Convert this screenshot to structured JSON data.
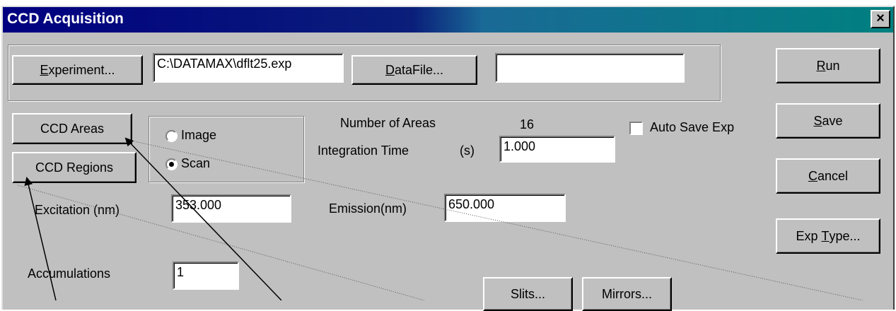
{
  "window": {
    "title": "CCD Acquisition",
    "close_glyph": "×"
  },
  "top_group": {
    "experiment_button": {
      "mnemonic": "E",
      "rest": "xperiment..."
    },
    "experiment_path": "C:\\DATAMAX\\dflt25.exp",
    "datafile_button": {
      "mnemonic": "D",
      "rest": "ataFile..."
    },
    "datafile_value": ""
  },
  "right_buttons": {
    "run": {
      "mnemonic": "R",
      "rest": "un"
    },
    "save": {
      "mnemonic": "S",
      "rest": "ave"
    },
    "cancel": {
      "mnemonic": "C",
      "rest": "ancel"
    },
    "exp_type": {
      "before": "Exp ",
      "mnemonic": "T",
      "rest": "ype..."
    }
  },
  "ccd": {
    "areas_button": "CCD Areas",
    "regions_button": "CCD Regions",
    "mode_options": [
      {
        "label": "Image",
        "selected": false
      },
      {
        "label": "Scan",
        "selected": true
      }
    ]
  },
  "params": {
    "number_of_areas_label": "Number of Areas",
    "number_of_areas_value": "16",
    "integration_time_label": "Integration Time",
    "integration_time_unit": "(s)",
    "integration_time_value": "1.000",
    "auto_save_label": "Auto Save Exp",
    "auto_save_checked": false,
    "excitation_label": "Excitation (nm)",
    "excitation_value": "353.000",
    "emission_label": "Emission(nm)",
    "emission_value": "650.000",
    "accumulations_label": "Accumulations",
    "accumulations_value": "1"
  },
  "bottom_buttons": {
    "slits": "Slits...",
    "mirrors": "Mirrors..."
  }
}
